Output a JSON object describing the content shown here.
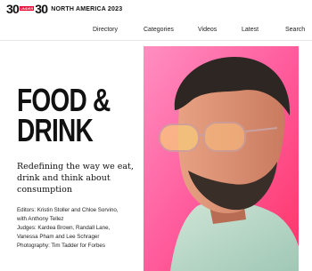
{
  "header": {
    "logo_left": "30",
    "logo_under": "UNDER",
    "logo_right": "30",
    "logo_tag": "NORTH AMERICA 2023"
  },
  "nav": {
    "items": [
      "Directory",
      "Categories",
      "Videos",
      "Latest",
      "Search"
    ]
  },
  "main": {
    "title_line1": "FOOD &",
    "title_line2": "DRINK",
    "subtitle": "Redefining the way we eat, drink and think about consumption",
    "credits": [
      "Editors: Kristin Stoller and Chloe Sorvino,",
      "with Anthony Tellez",
      "Judges: Kardea Brown, Randall Lane,",
      "Vanessa Pham and Lee Schrager",
      "Photography: Tim Tadder for Forbes"
    ]
  },
  "colors": {
    "accent": "#e4002b",
    "photo_bg": "#ff5c9d"
  }
}
